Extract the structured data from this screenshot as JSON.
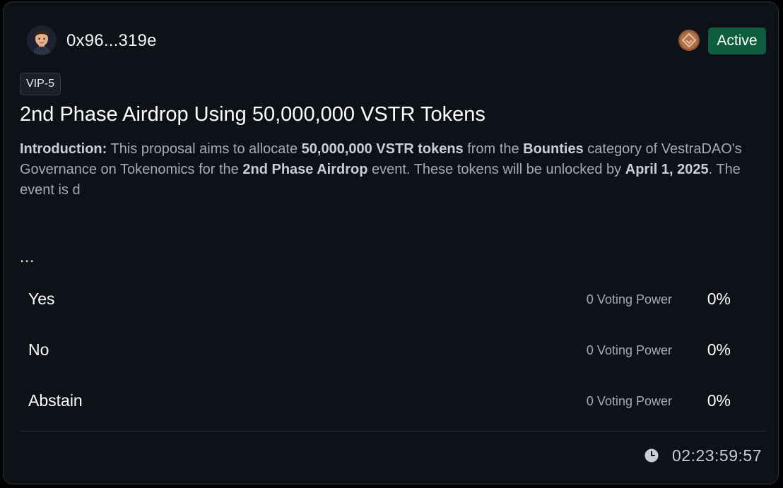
{
  "proposal": {
    "author": "0x96...319e",
    "status": "Active",
    "tag": "VIP-5",
    "title": "2nd Phase Airdrop Using 50,000,000 VSTR Tokens",
    "description": {
      "intro_label": "Introduction:",
      "t1": " This proposal aims to allocate ",
      "b1": "50,000,000 VSTR tokens",
      "t2": " from the ",
      "b2": "Bounties",
      "t3": " category of VestraDAO's Governance on Tokenomics for the ",
      "b3": "2nd Phase Airdrop",
      "t4": " event. These tokens will be unlocked by ",
      "b4": "April 1, 2025",
      "t5": ". The event is d"
    },
    "ellipsis": "...",
    "options": [
      {
        "label": "Yes",
        "power": "0 Voting Power",
        "percent": "0%"
      },
      {
        "label": "No",
        "power": "0 Voting Power",
        "percent": "0%"
      },
      {
        "label": "Abstain",
        "power": "0 Voting Power",
        "percent": "0%"
      }
    ],
    "countdown": "02:23:59:57"
  },
  "icons": {
    "avatar": "user-avatar",
    "badge": "bronze-badge-icon",
    "clock": "clock-icon"
  },
  "colors": {
    "background": "#0e1117",
    "status_active": "#0c5e3e",
    "badge_bronze": "#b0704a",
    "muted_text": "#a5abb5"
  }
}
